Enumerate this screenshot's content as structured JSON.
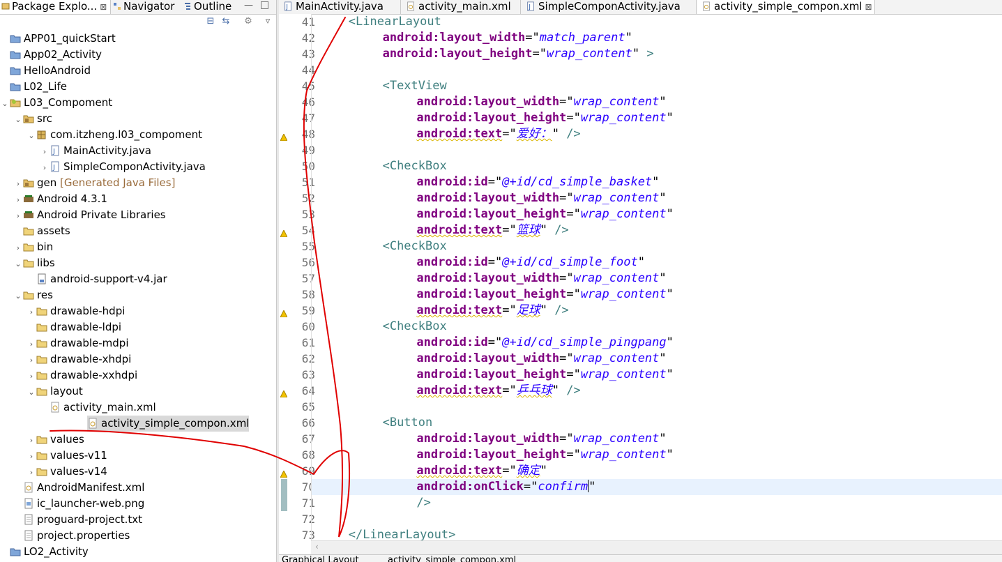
{
  "left_panel": {
    "tabs": [
      {
        "label": "Package Explo...",
        "close": "⊠"
      },
      {
        "label": "Navigator"
      },
      {
        "label": "Outline"
      }
    ],
    "tree": [
      {
        "label": "APP01_quickStart",
        "indent": 0,
        "twisty": "",
        "icon": "project"
      },
      {
        "label": "App02_Activity",
        "indent": 0,
        "twisty": "",
        "icon": "project"
      },
      {
        "label": "HelloAndroid",
        "indent": 0,
        "twisty": "",
        "icon": "project"
      },
      {
        "label": "L02_Life",
        "indent": 0,
        "twisty": "",
        "icon": "project"
      },
      {
        "label": "L03_Compoment",
        "indent": 0,
        "twisty": "v",
        "icon": "android-project"
      },
      {
        "label": "src",
        "indent": 1,
        "twisty": "v",
        "icon": "src-folder"
      },
      {
        "label": "com.itzheng.l03_compoment",
        "indent": 2,
        "twisty": "v",
        "icon": "package"
      },
      {
        "label": "MainActivity.java",
        "indent": 3,
        "twisty": ">",
        "icon": "java-file"
      },
      {
        "label": "SimpleComponActivity.java",
        "indent": 3,
        "twisty": ">",
        "icon": "java-file"
      },
      {
        "label": "gen",
        "suffix": "[Generated Java Files]",
        "indent": 1,
        "twisty": ">",
        "icon": "src-folder"
      },
      {
        "label": "Android 4.3.1",
        "indent": 1,
        "twisty": ">",
        "icon": "library"
      },
      {
        "label": "Android Private Libraries",
        "indent": 1,
        "twisty": ">",
        "icon": "library"
      },
      {
        "label": "assets",
        "indent": 1,
        "twisty": "",
        "icon": "folder"
      },
      {
        "label": "bin",
        "indent": 1,
        "twisty": ">",
        "icon": "folder"
      },
      {
        "label": "libs",
        "indent": 1,
        "twisty": "v",
        "icon": "folder"
      },
      {
        "label": "android-support-v4.jar",
        "indent": 2,
        "twisty": "",
        "icon": "jar-file"
      },
      {
        "label": "res",
        "indent": 1,
        "twisty": "v",
        "icon": "folder"
      },
      {
        "label": "drawable-hdpi",
        "indent": 2,
        "twisty": ">",
        "icon": "folder"
      },
      {
        "label": "drawable-ldpi",
        "indent": 2,
        "twisty": "",
        "icon": "folder"
      },
      {
        "label": "drawable-mdpi",
        "indent": 2,
        "twisty": ">",
        "icon": "folder"
      },
      {
        "label": "drawable-xhdpi",
        "indent": 2,
        "twisty": ">",
        "icon": "folder"
      },
      {
        "label": "drawable-xxhdpi",
        "indent": 2,
        "twisty": ">",
        "icon": "folder"
      },
      {
        "label": "layout",
        "indent": 2,
        "twisty": "v",
        "icon": "folder"
      },
      {
        "label": "activity_main.xml",
        "indent": 3,
        "twisty": "",
        "icon": "xml-file"
      },
      {
        "label": "activity_simple_compon.xml",
        "indent": 3,
        "twisty": "",
        "icon": "xml-file",
        "selected": true
      },
      {
        "label": "values",
        "indent": 2,
        "twisty": ">",
        "icon": "folder"
      },
      {
        "label": "values-v11",
        "indent": 2,
        "twisty": ">",
        "icon": "folder"
      },
      {
        "label": "values-v14",
        "indent": 2,
        "twisty": ">",
        "icon": "folder"
      },
      {
        "label": "AndroidManifest.xml",
        "indent": 1,
        "twisty": "",
        "icon": "xml-file"
      },
      {
        "label": "ic_launcher-web.png",
        "indent": 1,
        "twisty": "",
        "icon": "image-file"
      },
      {
        "label": "proguard-project.txt",
        "indent": 1,
        "twisty": "",
        "icon": "text-file"
      },
      {
        "label": "project.properties",
        "indent": 1,
        "twisty": "",
        "icon": "text-file"
      },
      {
        "label": "LO2_Activity",
        "indent": 0,
        "twisty": "",
        "icon": "project"
      }
    ]
  },
  "editor": {
    "tabs": [
      {
        "label": "MainActivity.java",
        "icon": "java-file"
      },
      {
        "label": "activity_main.xml",
        "icon": "xml-file"
      },
      {
        "label": "SimpleComponActivity.java",
        "icon": "java-file"
      },
      {
        "label": "activity_simple_compon.xml",
        "icon": "xml-file",
        "active": true,
        "close": "⊠"
      }
    ],
    "lines": [
      {
        "n": "41",
        "indent": 4,
        "parts": [
          [
            "tag",
            "<LinearLayout"
          ]
        ]
      },
      {
        "n": "42",
        "indent": 8,
        "parts": [
          [
            "attr",
            "android:layout_width"
          ],
          [
            "pun",
            "=\""
          ],
          [
            "val",
            "match_parent"
          ],
          [
            "pun",
            "\""
          ]
        ]
      },
      {
        "n": "43",
        "indent": 8,
        "parts": [
          [
            "attr",
            "android:layout_height"
          ],
          [
            "pun",
            "=\""
          ],
          [
            "val",
            "wrap_content"
          ],
          [
            "pun",
            "\""
          ],
          [
            "tag",
            " >"
          ]
        ]
      },
      {
        "n": "44",
        "indent": 0,
        "parts": []
      },
      {
        "n": "45",
        "indent": 8,
        "parts": [
          [
            "tag",
            "<TextView"
          ]
        ]
      },
      {
        "n": "46",
        "indent": 12,
        "parts": [
          [
            "attr",
            "android:layout_width"
          ],
          [
            "pun",
            "=\""
          ],
          [
            "val",
            "wrap_content"
          ],
          [
            "pun",
            "\""
          ]
        ]
      },
      {
        "n": "47",
        "indent": 12,
        "parts": [
          [
            "attr",
            "android:layout_height"
          ],
          [
            "pun",
            "=\""
          ],
          [
            "val",
            "wrap_content"
          ],
          [
            "pun",
            "\""
          ]
        ]
      },
      {
        "n": "48",
        "indent": 12,
        "warn": true,
        "parts": [
          [
            "attr",
            "android:text"
          ],
          [
            "pun",
            "=\""
          ],
          [
            "val",
            "爱好："
          ],
          [
            "pun",
            "\""
          ],
          [
            "tag",
            " />"
          ]
        ]
      },
      {
        "n": "49",
        "indent": 0,
        "parts": []
      },
      {
        "n": "50",
        "indent": 8,
        "parts": [
          [
            "tag",
            "<CheckBox"
          ]
        ]
      },
      {
        "n": "51",
        "indent": 12,
        "parts": [
          [
            "attr",
            "android:id"
          ],
          [
            "pun",
            "=\""
          ],
          [
            "val",
            "@+id/cd_simple_basket"
          ],
          [
            "pun",
            "\""
          ]
        ]
      },
      {
        "n": "52",
        "indent": 12,
        "parts": [
          [
            "attr",
            "android:layout_width"
          ],
          [
            "pun",
            "=\""
          ],
          [
            "val",
            "wrap_content"
          ],
          [
            "pun",
            "\""
          ]
        ]
      },
      {
        "n": "53",
        "indent": 12,
        "parts": [
          [
            "attr",
            "android:layout_height"
          ],
          [
            "pun",
            "=\""
          ],
          [
            "val",
            "wrap_content"
          ],
          [
            "pun",
            "\""
          ]
        ]
      },
      {
        "n": "54",
        "indent": 12,
        "warn": true,
        "parts": [
          [
            "attr",
            "android:text"
          ],
          [
            "pun",
            "=\""
          ],
          [
            "val",
            "篮球"
          ],
          [
            "pun",
            "\""
          ],
          [
            "tag",
            " />"
          ]
        ]
      },
      {
        "n": "55",
        "indent": 8,
        "parts": [
          [
            "tag",
            "<CheckBox"
          ]
        ]
      },
      {
        "n": "56",
        "indent": 12,
        "parts": [
          [
            "attr",
            "android:id"
          ],
          [
            "pun",
            "=\""
          ],
          [
            "val",
            "@+id/cd_simple_foot"
          ],
          [
            "pun",
            "\""
          ]
        ]
      },
      {
        "n": "57",
        "indent": 12,
        "parts": [
          [
            "attr",
            "android:layout_width"
          ],
          [
            "pun",
            "=\""
          ],
          [
            "val",
            "wrap_content"
          ],
          [
            "pun",
            "\""
          ]
        ]
      },
      {
        "n": "58",
        "indent": 12,
        "parts": [
          [
            "attr",
            "android:layout_height"
          ],
          [
            "pun",
            "=\""
          ],
          [
            "val",
            "wrap_content"
          ],
          [
            "pun",
            "\""
          ]
        ]
      },
      {
        "n": "59",
        "indent": 12,
        "warn": true,
        "parts": [
          [
            "attr",
            "android:text"
          ],
          [
            "pun",
            "=\""
          ],
          [
            "val",
            "足球"
          ],
          [
            "pun",
            "\""
          ],
          [
            "tag",
            " />"
          ]
        ]
      },
      {
        "n": "60",
        "indent": 8,
        "parts": [
          [
            "tag",
            "<CheckBox"
          ]
        ]
      },
      {
        "n": "61",
        "indent": 12,
        "parts": [
          [
            "attr",
            "android:id"
          ],
          [
            "pun",
            "=\""
          ],
          [
            "val",
            "@+id/cd_simple_pingpang"
          ],
          [
            "pun",
            "\""
          ]
        ]
      },
      {
        "n": "62",
        "indent": 12,
        "parts": [
          [
            "attr",
            "android:layout_width"
          ],
          [
            "pun",
            "=\""
          ],
          [
            "val",
            "wrap_content"
          ],
          [
            "pun",
            "\""
          ]
        ]
      },
      {
        "n": "63",
        "indent": 12,
        "parts": [
          [
            "attr",
            "android:layout_height"
          ],
          [
            "pun",
            "=\""
          ],
          [
            "val",
            "wrap_content"
          ],
          [
            "pun",
            "\""
          ]
        ]
      },
      {
        "n": "64",
        "indent": 12,
        "warn": true,
        "parts": [
          [
            "attr",
            "android:text"
          ],
          [
            "pun",
            "=\""
          ],
          [
            "val",
            "乒乓球"
          ],
          [
            "pun",
            "\""
          ],
          [
            "tag",
            " />"
          ]
        ]
      },
      {
        "n": "65",
        "indent": 0,
        "parts": []
      },
      {
        "n": "66",
        "indent": 8,
        "parts": [
          [
            "tag",
            "<Button"
          ]
        ]
      },
      {
        "n": "67",
        "indent": 12,
        "parts": [
          [
            "attr",
            "android:layout_width"
          ],
          [
            "pun",
            "=\""
          ],
          [
            "val",
            "wrap_content"
          ],
          [
            "pun",
            "\""
          ]
        ]
      },
      {
        "n": "68",
        "indent": 12,
        "parts": [
          [
            "attr",
            "android:layout_height"
          ],
          [
            "pun",
            "=\""
          ],
          [
            "val",
            "wrap_content"
          ],
          [
            "pun",
            "\""
          ]
        ]
      },
      {
        "n": "69",
        "indent": 12,
        "warn": true,
        "parts": [
          [
            "attr",
            "android:text"
          ],
          [
            "pun",
            "=\""
          ],
          [
            "val",
            "确定"
          ],
          [
            "pun",
            "\""
          ]
        ]
      },
      {
        "n": "70",
        "indent": 12,
        "current": true,
        "changed": true,
        "parts": [
          [
            "attr",
            "android:onClick"
          ],
          [
            "pun",
            "=\""
          ],
          [
            "val",
            "confirm"
          ],
          [
            "caret",
            ""
          ],
          [
            "pun",
            "\""
          ]
        ]
      },
      {
        "n": "71",
        "indent": 12,
        "changed": true,
        "parts": [
          [
            "tag",
            "/>"
          ]
        ]
      },
      {
        "n": "72",
        "indent": 0,
        "parts": []
      },
      {
        "n": "73",
        "indent": 4,
        "parts": [
          [
            "tag",
            "</LinearLayout>"
          ]
        ]
      }
    ],
    "bottom_tabs": [
      {
        "label": "Graphical Layout"
      },
      {
        "label": "activity_simple_compon.xml"
      }
    ]
  },
  "colors": {
    "tag": "#3f7f7f",
    "attr": "#7f007f",
    "value": "#2a00ff",
    "annotation": "#e00000"
  }
}
